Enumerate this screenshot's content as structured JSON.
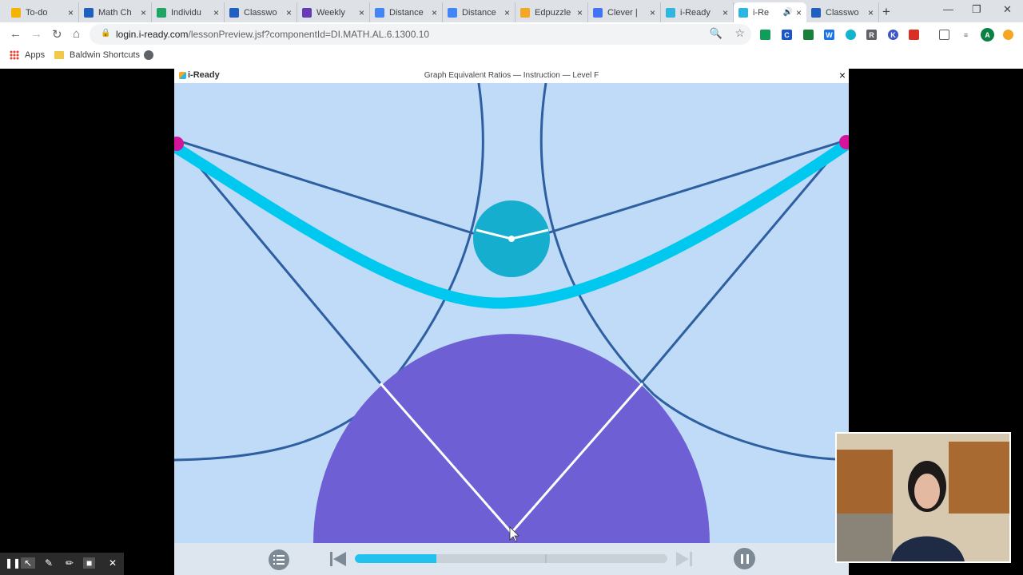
{
  "browser": {
    "tabs": [
      {
        "label": "To-do",
        "fav": "google-classroom-icon",
        "color": "#f4b400"
      },
      {
        "label": "Math Ch",
        "fav": "google-classroom-icon",
        "color": "#1e5fbf"
      },
      {
        "label": "Individu",
        "fav": "google-drive-icon",
        "color": "#1fa463"
      },
      {
        "label": "Classwo",
        "fav": "google-classroom-icon",
        "color": "#1e5fbf"
      },
      {
        "label": "Weekly",
        "fav": "google-forms-icon",
        "color": "#673ab7"
      },
      {
        "label": "Distance",
        "fav": "google-docs-icon",
        "color": "#4285f4"
      },
      {
        "label": "Distance",
        "fav": "google-docs-icon",
        "color": "#4285f4"
      },
      {
        "label": "Edpuzzle",
        "fav": "edpuzzle-icon",
        "color": "#f5a623"
      },
      {
        "label": "Clever |",
        "fav": "clever-icon",
        "color": "#4274f6"
      },
      {
        "label": "i-Ready",
        "fav": "iready-icon",
        "color": "#2fb6e0"
      },
      {
        "label": "i-Re",
        "fav": "iready-icon",
        "color": "#2fb6e0",
        "active": true
      },
      {
        "label": "Classwo",
        "fav": "google-classroom-icon",
        "color": "#1e5fbf"
      }
    ],
    "url_host": "login.i-ready.com",
    "url_path": "/lessonPreview.jsf?componentId=DI.MATH.AL.6.1300.10",
    "bookmarks": [
      {
        "label": "Apps",
        "icon": "apps-grid-icon"
      },
      {
        "label": "Baldwin Shortcuts",
        "icon": "folder-icon"
      },
      {
        "label": "",
        "icon": "globe-icon"
      }
    ]
  },
  "lesson": {
    "brand": "i-Ready",
    "title": "Graph Equivalent Ratios — Instruction — Level F",
    "close": "×"
  },
  "player": {
    "progress": 0.26,
    "colors": {
      "accent": "#22c2ee",
      "stage": "#c0dbf7",
      "circle": "#6e5fd4",
      "wheel": "#16aecf",
      "band": "#00c8ef",
      "line": "#2d5fa1",
      "pin": "#d4149a"
    }
  }
}
